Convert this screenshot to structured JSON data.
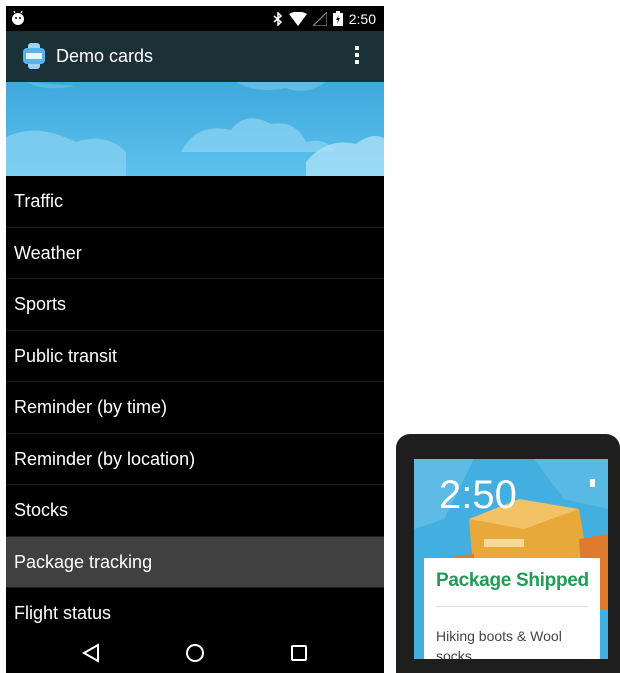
{
  "status": {
    "time": "2:50"
  },
  "app": {
    "title": "Demo cards"
  },
  "list": {
    "items": [
      {
        "label": "Traffic"
      },
      {
        "label": "Weather"
      },
      {
        "label": "Sports"
      },
      {
        "label": "Public transit"
      },
      {
        "label": "Reminder (by time)"
      },
      {
        "label": "Reminder (by location)"
      },
      {
        "label": "Stocks"
      },
      {
        "label": "Package tracking",
        "selected": true
      },
      {
        "label": "Flight status"
      }
    ]
  },
  "watch": {
    "time": "2:50",
    "card_title": "Package Shipped",
    "card_body": "Hiking boots & Wool socks"
  },
  "colors": {
    "actionbar": "#1c3037",
    "banner_sky": "#4bb8e6",
    "selected_row": "#404040",
    "card_title": "#1f9d55"
  }
}
